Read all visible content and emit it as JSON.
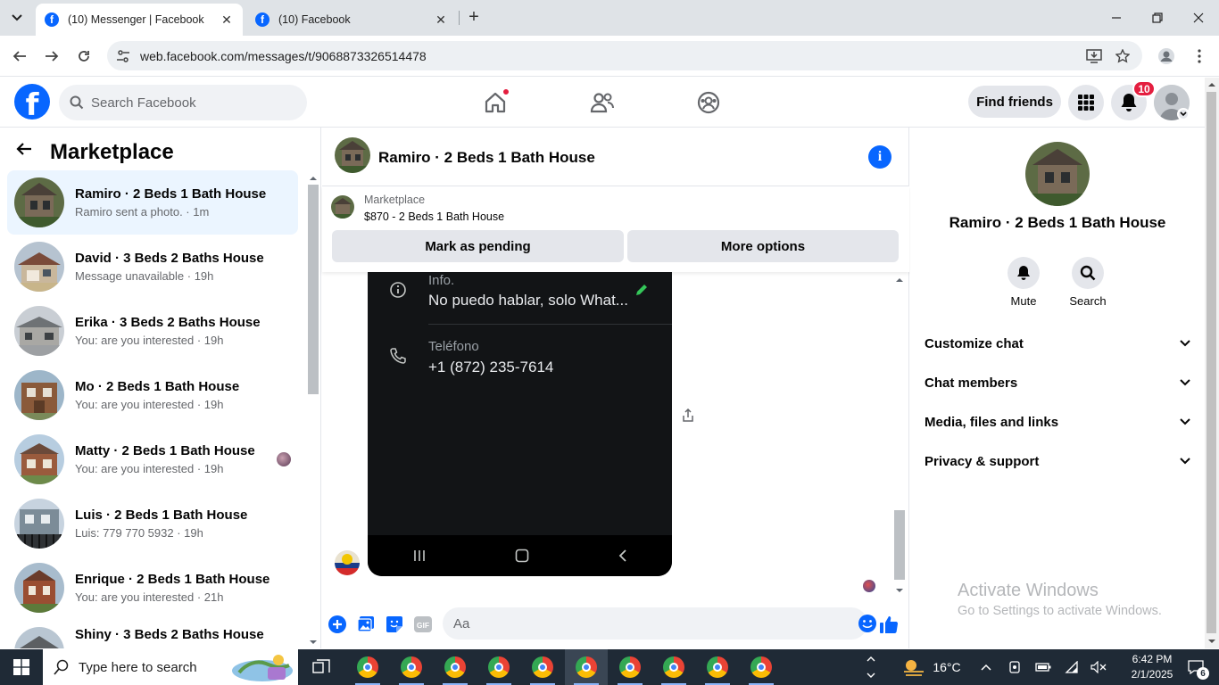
{
  "browser": {
    "tabs": [
      {
        "title": "(10) Messenger | Facebook",
        "active": true
      },
      {
        "title": "(10) Facebook",
        "active": false
      }
    ],
    "url": "web.facebook.com/messages/t/9068873326514478"
  },
  "header": {
    "logo": "f",
    "search_placeholder": "Search Facebook",
    "find_friends": "Find friends",
    "notification_count": "10"
  },
  "sidebar": {
    "title": "Marketplace",
    "conversations": [
      {
        "name": "Ramiro · 2 Beds 1 Bath House",
        "preview": "Ramiro sent a photo. · 1m",
        "selected": true
      },
      {
        "name": "David · 3 Beds 2 Baths House",
        "preview": "Message unavailable · 19h"
      },
      {
        "name": "Erika · 3 Beds 2 Baths House",
        "preview": "You: are you interested · 19h"
      },
      {
        "name": "Mo · 2 Beds 1 Bath House",
        "preview": "You: are you interested · 19h"
      },
      {
        "name": "Matty · 2 Beds 1 Bath House",
        "preview": "You: are you interested · 19h"
      },
      {
        "name": "Luis · 2 Beds 1 Bath House",
        "preview": "Luis: 779 770 5932 · 19h"
      },
      {
        "name": "Enrique · 2 Beds 1 Bath House",
        "preview": "You: are you interested · 21h"
      },
      {
        "name": "Shiny · 3 Beds 2 Baths House",
        "preview": ""
      }
    ]
  },
  "chat": {
    "title": "Ramiro · 2 Beds 1 Bath House",
    "listing": {
      "label": "Marketplace",
      "price_title": "$870 - 2 Beds 1 Bath House",
      "mark_pending": "Mark as pending",
      "more_options": "More options"
    },
    "photo": {
      "info_label": "Info.",
      "info_value": "No puedo hablar, solo What...",
      "phone_label": "Teléfono",
      "phone_value": "+1 (872) 235-7614"
    },
    "composer_placeholder": "Aa"
  },
  "details": {
    "name": "Ramiro · 2 Beds 1 Bath House",
    "actions": [
      {
        "label": "Mute",
        "icon": "bell-icon"
      },
      {
        "label": "Search",
        "icon": "search-icon"
      }
    ],
    "sections": [
      "Customize chat",
      "Chat members",
      "Media, files and links",
      "Privacy & support"
    ],
    "watermark_title": "Activate Windows",
    "watermark_sub": "Go to Settings to activate Windows."
  },
  "taskbar": {
    "search_placeholder": "Type here to search",
    "weather": "16°C",
    "time": "6:42 PM",
    "date": "2/1/2025",
    "notifications": "6"
  },
  "colors": {
    "fb_blue": "#0866ff",
    "selected_bg": "#ebf5ff",
    "badge_red": "#e41e3f"
  }
}
